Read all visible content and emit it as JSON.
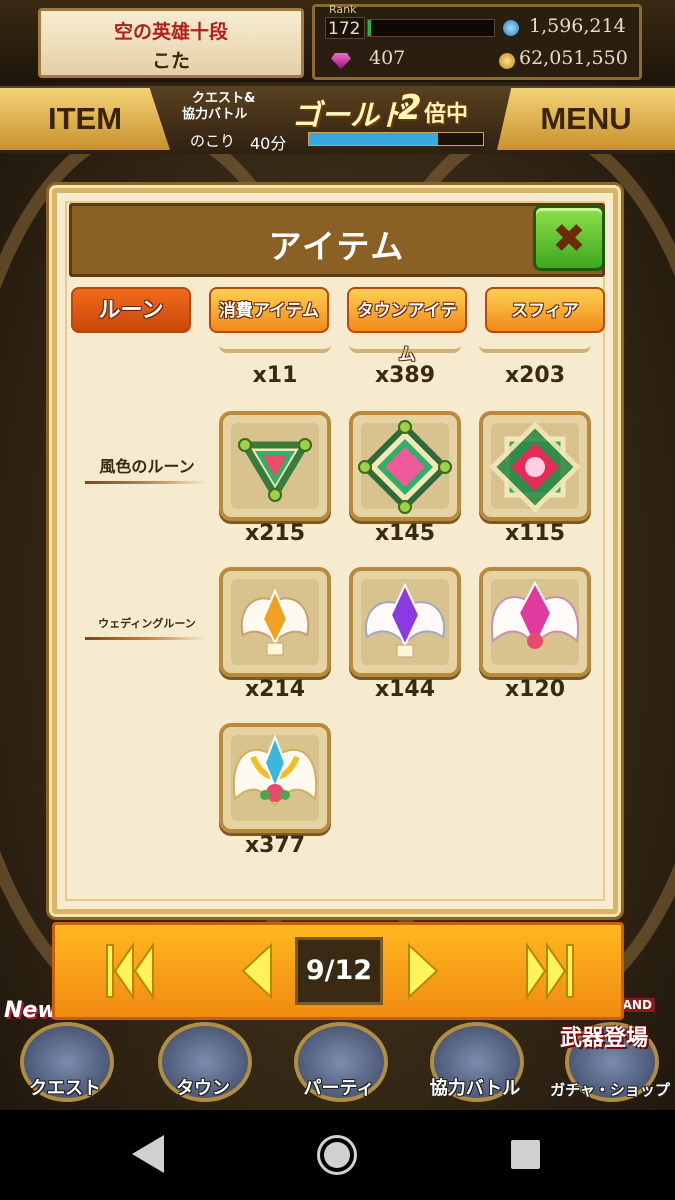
{
  "header": {
    "player_title": "空の英雄十段",
    "player_name": "こた",
    "rank_label": "Rank",
    "rank": "172",
    "rank_progress": 0.02,
    "stat_water": "1,596,214",
    "gems": "407",
    "gold": "62,051,550"
  },
  "topnav": {
    "item_label": "ITEM",
    "menu_label": "MENU",
    "bonus_line1": "クエスト&",
    "bonus_line2": "協力バトル",
    "bonus_gold": "ゴールド",
    "bonus_mult": "2",
    "bonus_suffix": "倍中",
    "remaining_label": "のこり",
    "remaining_time": "40分",
    "remaining_progress": 0.74
  },
  "dialog": {
    "title": "アイテム",
    "tabs": [
      {
        "label": "ルーン"
      },
      {
        "label": "消費アイテム"
      },
      {
        "label": "タウンアイテム"
      },
      {
        "label": "スフィア"
      }
    ],
    "top_counts": [
      "x11",
      "x389",
      "x203"
    ],
    "groups": [
      {
        "label": "風色のルーン",
        "counts": [
          "x215",
          "x145",
          "x115"
        ],
        "icons": [
          "triangle-rune-icon",
          "square-rune-icon",
          "star-rune-icon"
        ]
      },
      {
        "label": "ウェディングルーン",
        "counts": [
          "x214",
          "x144",
          "x120",
          "x377"
        ],
        "icons": [
          "winged-rune-icon",
          "winged-rune-icon",
          "winged-rune-icon",
          "winged-rune-icon"
        ]
      }
    ]
  },
  "pager": {
    "page": "9/12"
  },
  "bottom_nav": {
    "new_label": "New",
    "items": [
      {
        "label": "クエスト"
      },
      {
        "label": "タウン"
      },
      {
        "label": "パーティ"
      },
      {
        "label": "協力バトル"
      },
      {
        "label": "ガチャ・ショップ"
      }
    ],
    "weapon_label": "武器登場",
    "island_label": "LAND"
  },
  "colors": {
    "accent_orange": "#f08a10",
    "dialog_bg": "#f6ebcf",
    "close_green": "#3ea81e"
  }
}
